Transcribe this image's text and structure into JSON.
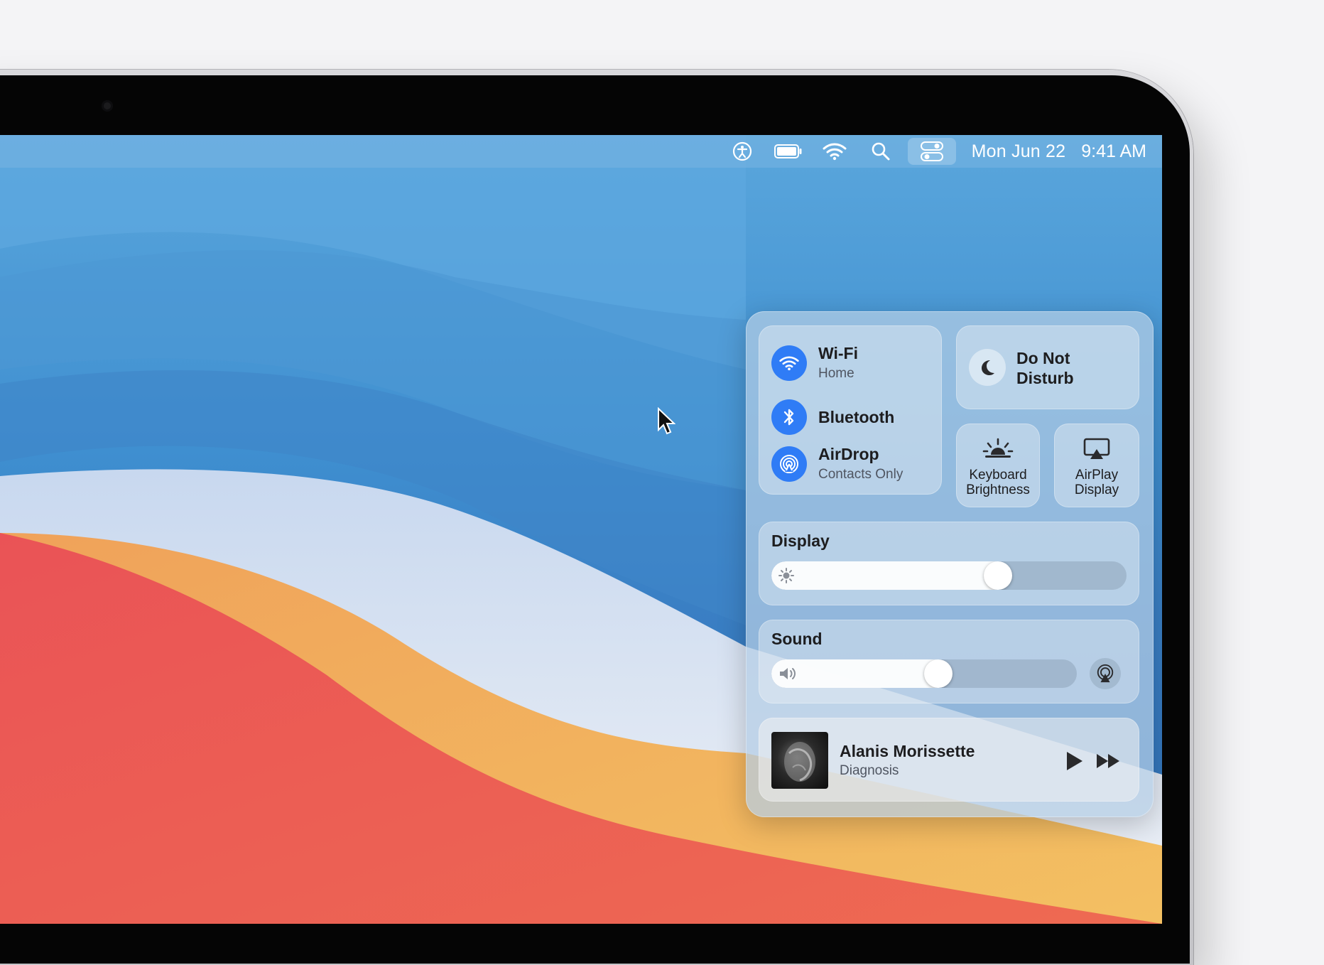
{
  "menubar": {
    "date": "Mon Jun 22",
    "time": "9:41 AM",
    "icons": [
      "accessibility-icon",
      "battery-icon",
      "wifi-icon",
      "search-icon",
      "control-center-icon"
    ]
  },
  "control_center": {
    "wifi": {
      "label": "Wi-Fi",
      "status": "Home"
    },
    "bluetooth": {
      "label": "Bluetooth"
    },
    "airdrop": {
      "label": "AirDrop",
      "status": "Contacts Only"
    },
    "do_not_disturb": {
      "label": "Do Not Disturb"
    },
    "keyboard_brightness": {
      "label_line1": "Keyboard",
      "label_line2": "Brightness"
    },
    "airplay_display": {
      "label_line1": "AirPlay",
      "label_line2": "Display"
    },
    "display": {
      "title": "Display",
      "level": 0.65
    },
    "sound": {
      "title": "Sound",
      "level": 0.55
    },
    "now_playing": {
      "artist": "Alanis Morissette",
      "track": "Diagnosis"
    }
  },
  "colors": {
    "accent": "#2f7cf6"
  }
}
